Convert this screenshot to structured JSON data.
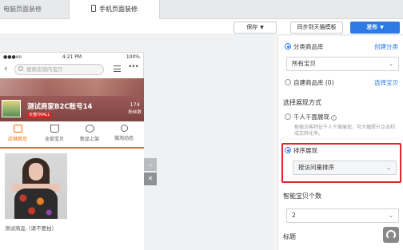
{
  "tabs": [
    {
      "label": "电脑页面装修",
      "active": false
    },
    {
      "label": "手机页面装修",
      "active": true
    }
  ],
  "toolbar": {
    "save_label": "保存",
    "sync_label": "同步到天猫模板",
    "publish_label": "发布"
  },
  "phone": {
    "signal": "●●●oo",
    "time": "4:21 PM",
    "battery": "100%",
    "search_placeholder": "搜索店铺内宝贝",
    "shop_name": "测试商家B2C账号14",
    "badge": "天猫TMALL",
    "fans_count": "174",
    "fans_label": "粉丝数",
    "nav": [
      {
        "label": "店铺首页",
        "icon": "shop-icon",
        "active": true
      },
      {
        "label": "全部宝贝",
        "icon": "cart-icon",
        "active": false
      },
      {
        "label": "新品上架",
        "icon": "chat-icon",
        "active": false
      },
      {
        "label": "微淘动态",
        "icon": "broadcast-icon",
        "active": false
      }
    ],
    "product_name": "测试商品（请不要拍）"
  },
  "panel": {
    "category_lib_label": "分类商品库",
    "create_category_link": "创建分类",
    "category_select": "所有宝贝",
    "custom_lib_label": "自建商品库 (0)",
    "select_goods_link": "选择宝贝",
    "display_mode_title": "选择展现方式",
    "personalized_label": "千人千面展现",
    "personalized_help": "根据访客特征千人千面展现，可大幅提升点击和成交转化率。",
    "sort_label": "排序展现",
    "sort_select": "按访问量排序",
    "smart_count_title": "智能宝贝个数",
    "smart_count_value": "2",
    "title_label": "标题"
  },
  "colors": {
    "accent_blue": "#2d7ae6",
    "nav_active": "#ff6a00",
    "highlight_red": "#e0262b"
  }
}
